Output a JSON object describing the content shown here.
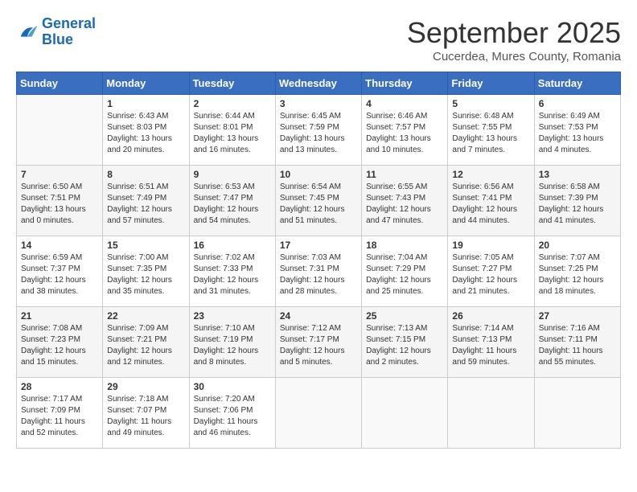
{
  "logo": {
    "text_general": "General",
    "text_blue": "Blue"
  },
  "title": "September 2025",
  "subtitle": "Cucerdea, Mures County, Romania",
  "days_of_week": [
    "Sunday",
    "Monday",
    "Tuesday",
    "Wednesday",
    "Thursday",
    "Friday",
    "Saturday"
  ],
  "weeks": [
    [
      {
        "day": "",
        "info": ""
      },
      {
        "day": "1",
        "info": "Sunrise: 6:43 AM\nSunset: 8:03 PM\nDaylight: 13 hours\nand 20 minutes."
      },
      {
        "day": "2",
        "info": "Sunrise: 6:44 AM\nSunset: 8:01 PM\nDaylight: 13 hours\nand 16 minutes."
      },
      {
        "day": "3",
        "info": "Sunrise: 6:45 AM\nSunset: 7:59 PM\nDaylight: 13 hours\nand 13 minutes."
      },
      {
        "day": "4",
        "info": "Sunrise: 6:46 AM\nSunset: 7:57 PM\nDaylight: 13 hours\nand 10 minutes."
      },
      {
        "day": "5",
        "info": "Sunrise: 6:48 AM\nSunset: 7:55 PM\nDaylight: 13 hours\nand 7 minutes."
      },
      {
        "day": "6",
        "info": "Sunrise: 6:49 AM\nSunset: 7:53 PM\nDaylight: 13 hours\nand 4 minutes."
      }
    ],
    [
      {
        "day": "7",
        "info": "Sunrise: 6:50 AM\nSunset: 7:51 PM\nDaylight: 13 hours\nand 0 minutes."
      },
      {
        "day": "8",
        "info": "Sunrise: 6:51 AM\nSunset: 7:49 PM\nDaylight: 12 hours\nand 57 minutes."
      },
      {
        "day": "9",
        "info": "Sunrise: 6:53 AM\nSunset: 7:47 PM\nDaylight: 12 hours\nand 54 minutes."
      },
      {
        "day": "10",
        "info": "Sunrise: 6:54 AM\nSunset: 7:45 PM\nDaylight: 12 hours\nand 51 minutes."
      },
      {
        "day": "11",
        "info": "Sunrise: 6:55 AM\nSunset: 7:43 PM\nDaylight: 12 hours\nand 47 minutes."
      },
      {
        "day": "12",
        "info": "Sunrise: 6:56 AM\nSunset: 7:41 PM\nDaylight: 12 hours\nand 44 minutes."
      },
      {
        "day": "13",
        "info": "Sunrise: 6:58 AM\nSunset: 7:39 PM\nDaylight: 12 hours\nand 41 minutes."
      }
    ],
    [
      {
        "day": "14",
        "info": "Sunrise: 6:59 AM\nSunset: 7:37 PM\nDaylight: 12 hours\nand 38 minutes."
      },
      {
        "day": "15",
        "info": "Sunrise: 7:00 AM\nSunset: 7:35 PM\nDaylight: 12 hours\nand 35 minutes."
      },
      {
        "day": "16",
        "info": "Sunrise: 7:02 AM\nSunset: 7:33 PM\nDaylight: 12 hours\nand 31 minutes."
      },
      {
        "day": "17",
        "info": "Sunrise: 7:03 AM\nSunset: 7:31 PM\nDaylight: 12 hours\nand 28 minutes."
      },
      {
        "day": "18",
        "info": "Sunrise: 7:04 AM\nSunset: 7:29 PM\nDaylight: 12 hours\nand 25 minutes."
      },
      {
        "day": "19",
        "info": "Sunrise: 7:05 AM\nSunset: 7:27 PM\nDaylight: 12 hours\nand 21 minutes."
      },
      {
        "day": "20",
        "info": "Sunrise: 7:07 AM\nSunset: 7:25 PM\nDaylight: 12 hours\nand 18 minutes."
      }
    ],
    [
      {
        "day": "21",
        "info": "Sunrise: 7:08 AM\nSunset: 7:23 PM\nDaylight: 12 hours\nand 15 minutes."
      },
      {
        "day": "22",
        "info": "Sunrise: 7:09 AM\nSunset: 7:21 PM\nDaylight: 12 hours\nand 12 minutes."
      },
      {
        "day": "23",
        "info": "Sunrise: 7:10 AM\nSunset: 7:19 PM\nDaylight: 12 hours\nand 8 minutes."
      },
      {
        "day": "24",
        "info": "Sunrise: 7:12 AM\nSunset: 7:17 PM\nDaylight: 12 hours\nand 5 minutes."
      },
      {
        "day": "25",
        "info": "Sunrise: 7:13 AM\nSunset: 7:15 PM\nDaylight: 12 hours\nand 2 minutes."
      },
      {
        "day": "26",
        "info": "Sunrise: 7:14 AM\nSunset: 7:13 PM\nDaylight: 11 hours\nand 59 minutes."
      },
      {
        "day": "27",
        "info": "Sunrise: 7:16 AM\nSunset: 7:11 PM\nDaylight: 11 hours\nand 55 minutes."
      }
    ],
    [
      {
        "day": "28",
        "info": "Sunrise: 7:17 AM\nSunset: 7:09 PM\nDaylight: 11 hours\nand 52 minutes."
      },
      {
        "day": "29",
        "info": "Sunrise: 7:18 AM\nSunset: 7:07 PM\nDaylight: 11 hours\nand 49 minutes."
      },
      {
        "day": "30",
        "info": "Sunrise: 7:20 AM\nSunset: 7:06 PM\nDaylight: 11 hours\nand 46 minutes."
      },
      {
        "day": "",
        "info": ""
      },
      {
        "day": "",
        "info": ""
      },
      {
        "day": "",
        "info": ""
      },
      {
        "day": "",
        "info": ""
      }
    ]
  ]
}
